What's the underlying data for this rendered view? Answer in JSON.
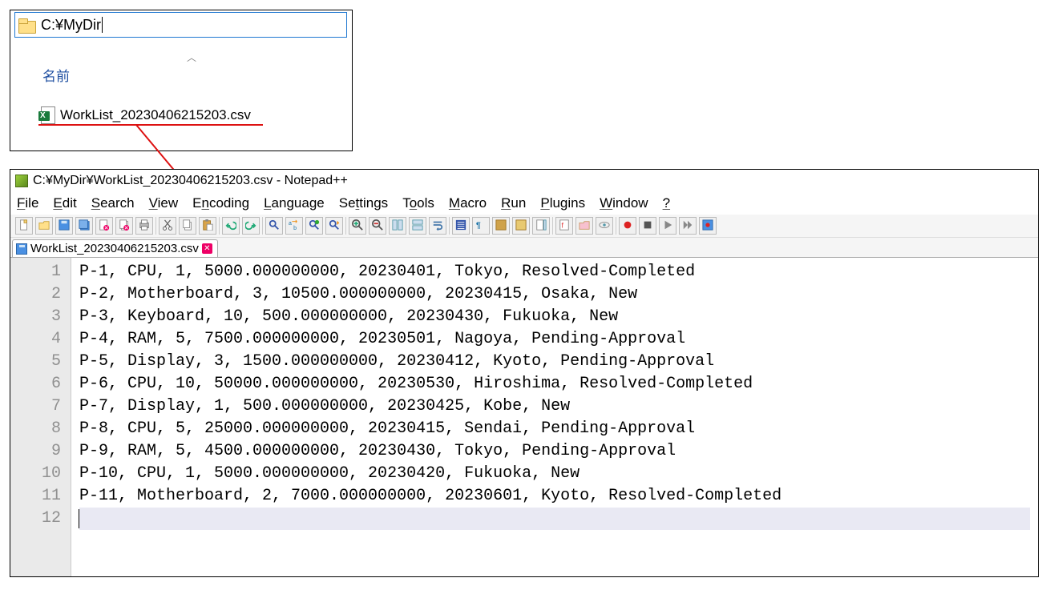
{
  "explorer": {
    "path": "C:¥MyDir",
    "column_header": "名前",
    "filename": "WorkList_20230406215203.csv"
  },
  "notepadpp": {
    "title": "C:¥MyDir¥WorkList_20230406215203.csv - Notepad++",
    "menu": {
      "file": "File",
      "edit": "Edit",
      "search": "Search",
      "view": "View",
      "encoding": "Encoding",
      "language": "Language",
      "settings": "Settings",
      "tools": "Tools",
      "macro": "Macro",
      "run": "Run",
      "plugins": "Plugins",
      "window": "Window",
      "help": "?"
    },
    "tab_label": "WorkList_20230406215203.csv",
    "lines": [
      "P-1, CPU, 1, 5000.000000000, 20230401, Tokyo, Resolved-Completed",
      "P-2, Motherboard, 3, 10500.000000000, 20230415, Osaka, New",
      "P-3, Keyboard, 10, 500.000000000, 20230430, Fukuoka, New",
      "P-4, RAM, 5, 7500.000000000, 20230501, Nagoya, Pending-Approval",
      "P-5, Display, 3, 1500.000000000, 20230412, Kyoto, Pending-Approval",
      "P-6, CPU, 10, 50000.000000000, 20230530, Hiroshima, Resolved-Completed",
      "P-7, Display, 1, 500.000000000, 20230425, Kobe, New",
      "P-8, CPU, 5, 25000.000000000, 20230415, Sendai, Pending-Approval",
      "P-9, RAM, 5, 4500.000000000, 20230430, Tokyo, Pending-Approval",
      "P-10, CPU, 1, 5000.000000000, 20230420, Fukuoka, New",
      "P-11, Motherboard, 2, 7000.000000000, 20230601, Kyoto, Resolved-Completed",
      ""
    ]
  },
  "toolbar_icons": [
    "new",
    "open",
    "save",
    "save-all",
    "close",
    "close-all",
    "print",
    "sep",
    "cut",
    "copy",
    "paste",
    "sep",
    "undo",
    "redo",
    "sep",
    "find",
    "find-replace",
    "find-in-files",
    "find-next",
    "sep",
    "zoom-in",
    "zoom-out",
    "sync-v",
    "sync-h",
    "wrap",
    "sep",
    "indent-guide",
    "all-chars",
    "fold",
    "unfold",
    "doc-map",
    "sep",
    "function-list",
    "folder",
    "eye",
    "sep",
    "record",
    "stop",
    "play",
    "play-multi",
    "save-macro"
  ]
}
